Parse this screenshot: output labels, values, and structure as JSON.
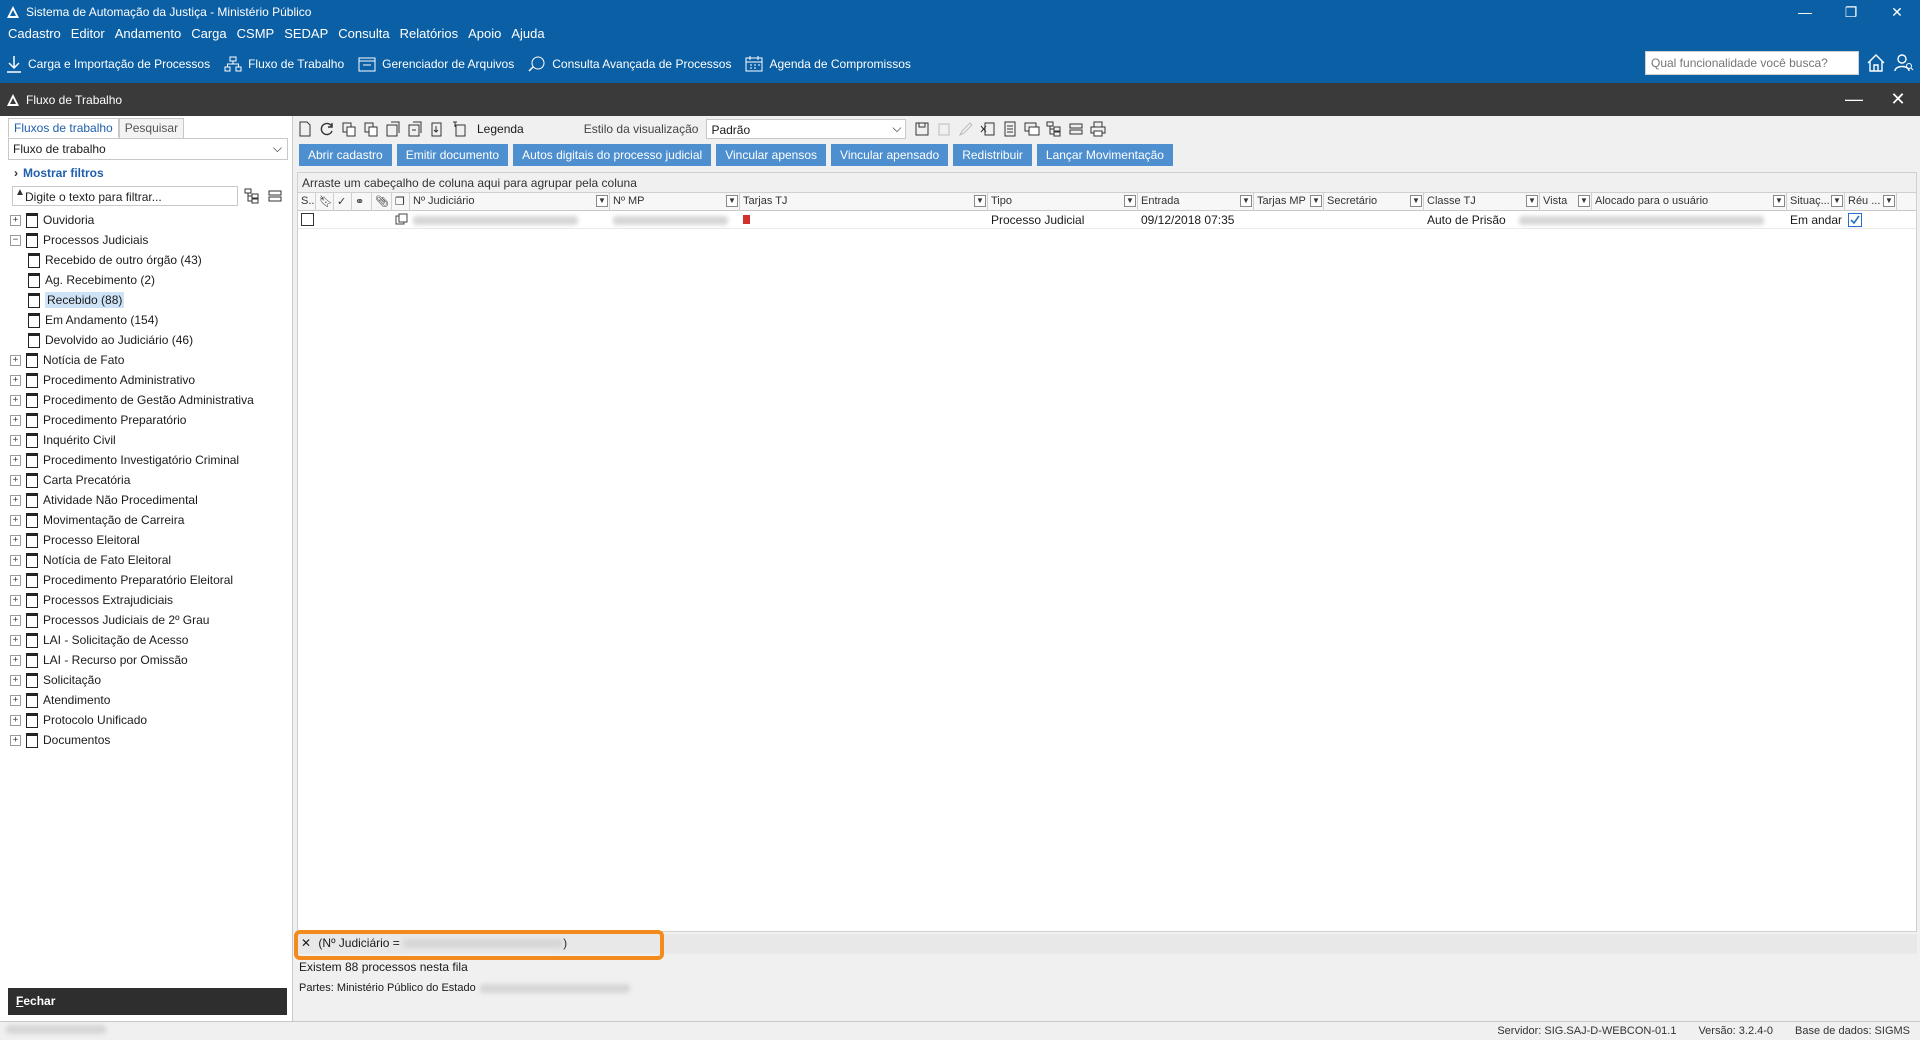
{
  "window": {
    "title": "Sistema de Automação da Justiça - Ministério Público"
  },
  "menu": [
    "Cadastro",
    "Editor",
    "Andamento",
    "Carga",
    "CSMP",
    "SEDAP",
    "Consulta",
    "Relatórios",
    "Apoio",
    "Ajuda"
  ],
  "quickbar": {
    "items": [
      "Carga e Importação de Processos",
      "Fluxo de Trabalho",
      "Gerenciador de Arquivos",
      "Consulta Avançada de Processos",
      "Agenda de Compromissos"
    ],
    "search_placeholder": "Qual funcionalidade você busca?"
  },
  "panel_header": {
    "title": "Fluxo de Trabalho"
  },
  "left": {
    "tabs": [
      "Fluxos de trabalho",
      "Pesquisar"
    ],
    "dropdown_value": "Fluxo de trabalho",
    "show_filters": "Mostrar filtros",
    "filter_placeholder": "Digite o texto para filtrar...",
    "tree": [
      {
        "label": "Ouvidoria",
        "expander": "+"
      },
      {
        "label": "Processos Judiciais",
        "expander": "−"
      },
      {
        "label": "Recebido de outro órgão (43)",
        "child": true
      },
      {
        "label": "Ag. Recebimento (2)",
        "child": true
      },
      {
        "label": "Recebido (88)",
        "child": true,
        "selected": true
      },
      {
        "label": "Em Andamento (154)",
        "child": true
      },
      {
        "label": "Devolvido ao Judiciário (46)",
        "child": true
      },
      {
        "label": "Notícia de Fato",
        "expander": "+"
      },
      {
        "label": "Procedimento Administrativo",
        "expander": "+"
      },
      {
        "label": "Procedimento de Gestão Administrativa",
        "expander": "+"
      },
      {
        "label": "Procedimento Preparatório",
        "expander": "+"
      },
      {
        "label": "Inquérito Civil",
        "expander": "+"
      },
      {
        "label": "Procedimento Investigatório Criminal",
        "expander": "+"
      },
      {
        "label": "Carta Precatória",
        "expander": "+"
      },
      {
        "label": "Atividade Não Procedimental",
        "expander": "+"
      },
      {
        "label": "Movimentação de Carreira",
        "expander": "+"
      },
      {
        "label": "Processo Eleitoral",
        "expander": "+"
      },
      {
        "label": "Notícia de Fato Eleitoral",
        "expander": "+"
      },
      {
        "label": "Procedimento Preparatório Eleitoral",
        "expander": "+"
      },
      {
        "label": "Processos Extrajudiciais",
        "expander": "+"
      },
      {
        "label": "Processos Judiciais de 2º Grau",
        "expander": "+"
      },
      {
        "label": "LAI - Solicitação de Acesso",
        "expander": "+"
      },
      {
        "label": "LAI - Recurso por Omissão",
        "expander": "+"
      },
      {
        "label": "Solicitação",
        "expander": "+"
      },
      {
        "label": "Atendimento",
        "expander": "+"
      },
      {
        "label": "Protocolo Unificado",
        "expander": "+"
      },
      {
        "label": "Documentos",
        "expander": "+"
      }
    ],
    "close_label_prefix": "F",
    "close_label_rest": "echar"
  },
  "right": {
    "legend_label": "Legenda",
    "style_label": "Estilo da visualização",
    "style_value": "Padrão",
    "actions": [
      "Abrir cadastro",
      "Emitir documento",
      "Autos digitais do processo judicial",
      "Vincular apensos",
      "Vincular apensado",
      "Redistribuir",
      "Lançar Movimentação"
    ],
    "group_hint": "Arraste um cabeçalho de coluna aqui para agrupar pela coluna",
    "columns": [
      "S...",
      "",
      "",
      "",
      "",
      "",
      "Nº Judiciário",
      "Nº MP",
      "Tarjas TJ",
      "Tipo",
      "Entrada",
      "Tarjas MP",
      "Secretário",
      "Classe TJ",
      "Vista",
      "Alocado para o usuário",
      "Situaç...",
      "Réu ..."
    ],
    "row": {
      "tipo": "Processo Judicial",
      "entrada": "09/12/2018 07:35",
      "classe": "Auto de Prisão",
      "situacao": "Em andar"
    },
    "filter_text_prefix": "(Nº Judiciário = ",
    "filter_text_suffix": ")",
    "count_text": "Existem 88 processos nesta fila",
    "partes_text": "Partes: Ministério Público do Estado"
  },
  "status": {
    "servidor": "Servidor: SIG.SAJ-D-WEBCON-01.1",
    "versao": "Versão: 3.2.4-0",
    "base": "Base de dados: SIGMS"
  },
  "colors": {
    "brand": "#0b5fa4",
    "dark_header": "#3a3a3a",
    "action_button": "#4d8fcf",
    "highlight": "#f28a1c",
    "tarja": "#d0312d"
  }
}
